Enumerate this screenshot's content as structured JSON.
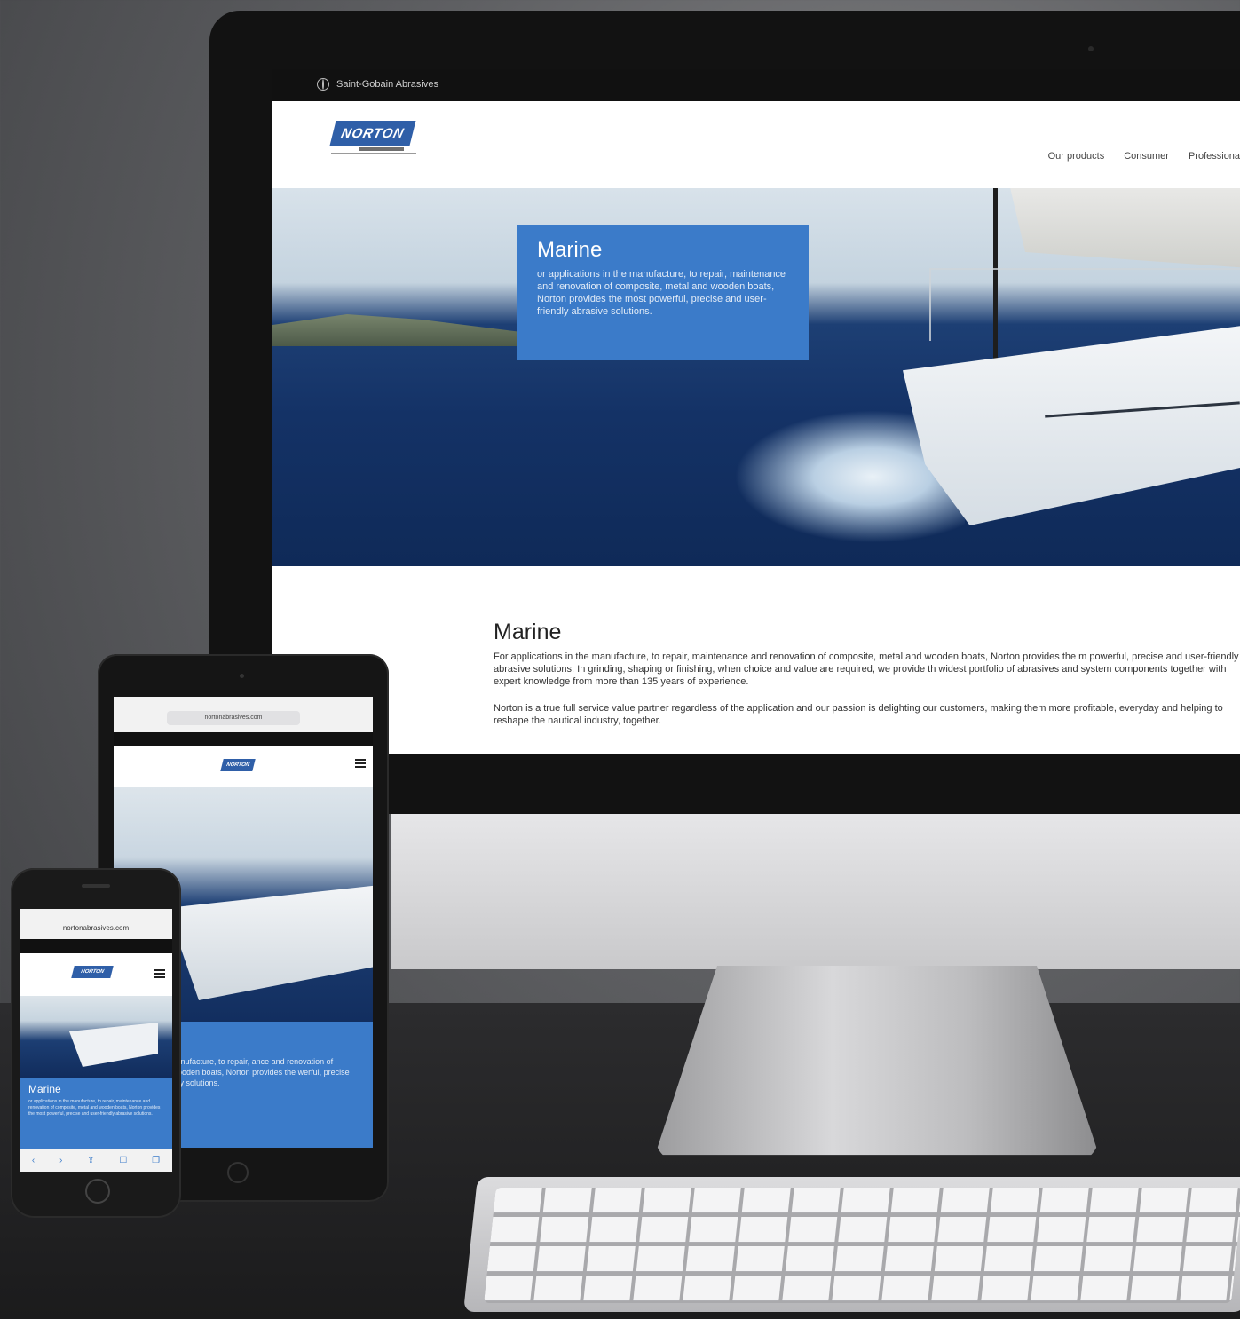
{
  "desktop": {
    "topbar_brand": "Saint-Gobain Abrasives",
    "logo_text": "NORTON",
    "nav": [
      "Our products",
      "Consumer",
      "Professionals"
    ],
    "hero": {
      "title": "Marine",
      "text": "or applications in the manufacture, to repair, maintenance and renovation of composite, metal and wooden boats, Norton provides the most powerful, precise and user- friendly abrasive solutions."
    },
    "content": {
      "title": "Marine",
      "paragraph1": "For applications in the manufacture, to repair, maintenance and renovation of composite, metal and wooden boats, Norton provides the m powerful, precise and user-friendly abrasive solutions. In grinding, shaping or finishing, when choice and value are required, we provide th widest portfolio of abrasives and system components together with expert knowledge from more than 135 years of experience.",
      "paragraph2": "Norton is a true full service value partner regardless of the application and our passion is delighting our customers, making them more profitable, everyday and helping to reshape the nautical industry, together."
    }
  },
  "tablet": {
    "url": "nortonabrasives.com",
    "logo_text": "NORTON",
    "hero_title": "ne",
    "hero_text": "ations in the manufacture, to repair, ance and renovation of composite, d wooden boats, Norton provides the werful, precise and user-friendly solutions."
  },
  "phone": {
    "url": "nortonabrasives.com",
    "logo_text": "NORTON",
    "hero_title": "Marine",
    "hero_text": "or applications in the manufacture, to repair, maintenance and renovation of composite, metal and wooden boats, Norton provides the most powerful, precise and user-friendly abrasive solutions.",
    "toolbar": [
      "‹",
      "›",
      "⇪",
      "☐",
      "❐"
    ]
  }
}
